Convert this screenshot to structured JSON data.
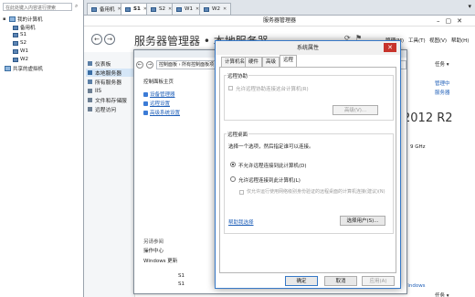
{
  "tree": {
    "search_placeholder": "在此处键入内容进行搜索",
    "root": "我的计算机",
    "vms": [
      "备用机",
      "S1",
      "S2",
      "W1",
      "W2"
    ],
    "shared": "共享的虚拟机"
  },
  "tabs": [
    "备用机",
    "S1",
    "S2",
    "W1",
    "W2"
  ],
  "window": {
    "title": "服务器管理器",
    "breadcrumb": "服务器管理器 • 本地服务器",
    "menus": [
      "管理(M)",
      "工具(T)",
      "视图(V)",
      "帮助(H)"
    ]
  },
  "sidebar": {
    "items": [
      "仪表板",
      "本地服务器",
      "所有服务器",
      "IIS",
      "文件和存储服",
      "远程访问"
    ]
  },
  "control_panel": {
    "address": "控制面板 › 所有控制面板项 › 系统",
    "home": "控制面板主页",
    "links": [
      "设备管理器",
      "远程设置",
      "高级系统设置"
    ],
    "see_also": "另请参阅",
    "see_also_links": [
      "操作中心",
      "Windows 更新"
    ]
  },
  "right_info": {
    "os_version": "2012 R2",
    "cpu": "9 GHz",
    "windows_label": "Windows",
    "tasks": "任务",
    "list": [
      "S1",
      "S1",
      "S1",
      "S1"
    ],
    "frag1": "管理中",
    "frag2": "服务器"
  },
  "dialog": {
    "title": "系统属性",
    "tabs": [
      "计算机名",
      "硬件",
      "高级",
      "远程"
    ],
    "remote_assistance": {
      "heading": "远程协助",
      "checkbox": "允许远程协助连接这台计算机(R)",
      "advanced_button": "高级(V)..."
    },
    "remote_desktop": {
      "heading": "远程桌面",
      "prompt": "选择一个选项，然后指定谁可以连接。",
      "option_deny": "不允许远程连接到此计算机(D)",
      "option_allow": "允许远程连接到此计算机(L)",
      "nla": "仅允许运行使用网络级别身份验证的远程桌面的计算机连接(建议)(N)",
      "help_link": "帮助我选择",
      "select_users_button": "选择用户(S)..."
    },
    "buttons": {
      "ok": "确定",
      "cancel": "取消",
      "apply": "应用(A)"
    }
  }
}
